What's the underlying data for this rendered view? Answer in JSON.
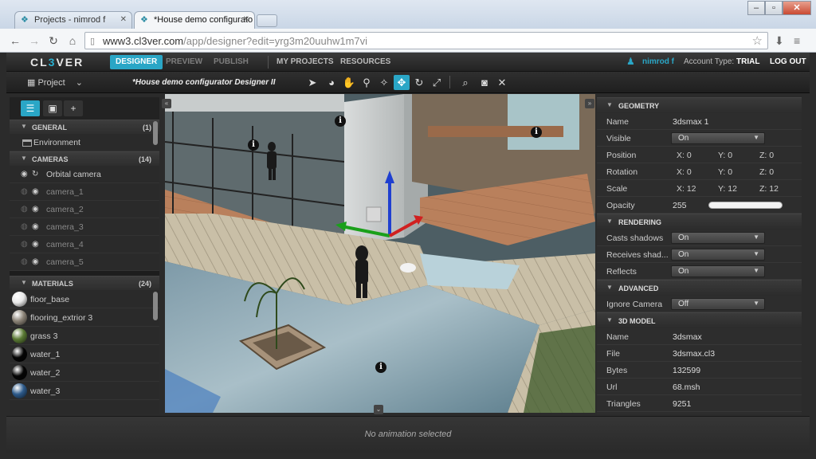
{
  "browser": {
    "tabs": [
      {
        "title": "Projects - nimrod f"
      },
      {
        "title": "*House demo configurato"
      }
    ],
    "url_domain": "www3.cl3ver.com",
    "url_path": "/app/designer?edit=yrg3m20uuhw1m7vi"
  },
  "app": {
    "logo_a": "CL",
    "logo_b": "3",
    "logo_c": "VER",
    "nav": [
      "DESIGNER",
      "PREVIEW",
      "PUBLISH",
      "MY PROJECTS",
      "RESOURCES"
    ],
    "user": "nimrod f",
    "account_label": "Account Type:",
    "account_type": "TRIAL",
    "logout": "LOG OUT"
  },
  "project_bar": {
    "project_label": "Project",
    "title": "*House demo configurator Designer II"
  },
  "left_panel": {
    "general": {
      "title": "GENERAL",
      "count": "(1)",
      "items": [
        "Environment"
      ]
    },
    "cameras": {
      "title": "CAMERAS",
      "count": "(14)",
      "items": [
        "Orbital camera",
        "camera_1",
        "camera_2",
        "camera_3",
        "camera_4",
        "camera_5"
      ]
    },
    "materials": {
      "title": "MATERIALS",
      "count": "(24)",
      "items": [
        {
          "name": "floor_base",
          "color": "#e8e8e8"
        },
        {
          "name": "flooring_extrior 3",
          "color": "#8c8478"
        },
        {
          "name": "grass 3",
          "color": "#5a7a34"
        },
        {
          "name": "water_1",
          "color": "#050505"
        },
        {
          "name": "water_2",
          "color": "#050505"
        },
        {
          "name": "water_3",
          "color": "#2d5a8a"
        }
      ]
    }
  },
  "right_panel": {
    "geometry": {
      "title": "GEOMETRY",
      "name_label": "Name",
      "name_value": "3dsmax 1",
      "visible_label": "Visible",
      "visible_value": "On",
      "position_label": "Position",
      "position": {
        "x": "X: 0",
        "y": "Y: 0",
        "z": "Z: 0"
      },
      "rotation_label": "Rotation",
      "rotation": {
        "x": "X: 0",
        "y": "Y: 0",
        "z": "Z: 0"
      },
      "scale_label": "Scale",
      "scale": {
        "x": "X: 12",
        "y": "Y: 12",
        "z": "Z: 12"
      },
      "opacity_label": "Opacity",
      "opacity_value": "255"
    },
    "rendering": {
      "title": "RENDERING",
      "casts_label": "Casts shadows",
      "casts_value": "On",
      "receives_label": "Receives shad...",
      "receives_value": "On",
      "reflects_label": "Reflects",
      "reflects_value": "On"
    },
    "advanced": {
      "title": "ADVANCED",
      "ignore_label": "Ignore Camera",
      "ignore_value": "Off"
    },
    "model": {
      "title": "3D MODEL",
      "name_label": "Name",
      "name_value": "3dsmax",
      "file_label": "File",
      "file_value": "3dsmax.cl3",
      "bytes_label": "Bytes",
      "bytes_value": "132599",
      "url_label": "Url",
      "url_value": "68.msh",
      "tri_label": "Triangles",
      "tri_value": "9251"
    }
  },
  "bottom": {
    "status": "No animation selected"
  },
  "colors": {
    "accent": "#2aa6c6"
  }
}
